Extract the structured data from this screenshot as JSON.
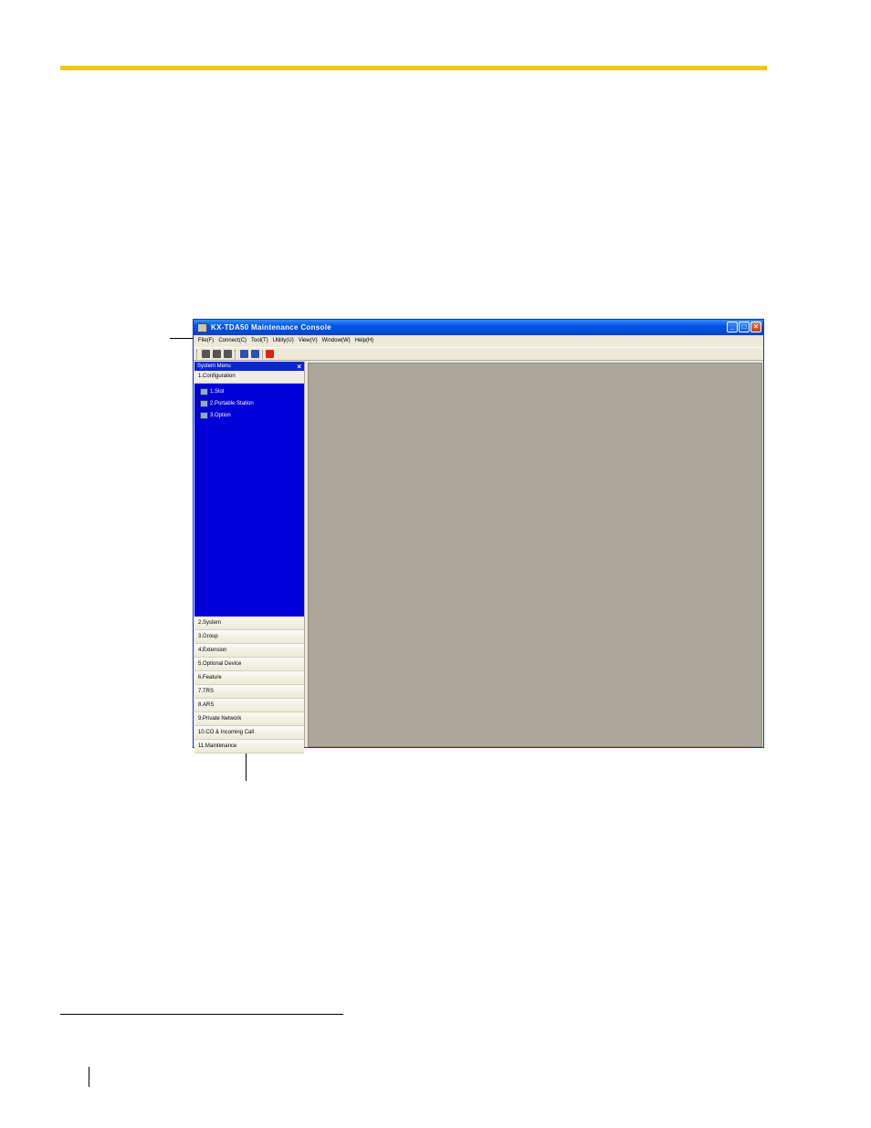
{
  "window": {
    "title": "KX-TDA50 Maintenance Console",
    "controls": {
      "minimize": "_",
      "maximize": "□",
      "close": "×"
    }
  },
  "menubar": {
    "items": [
      "File(F)",
      "Connect(C)",
      "Tool(T)",
      "Utility(U)",
      "View(V)",
      "Window(W)",
      "Help(H)"
    ]
  },
  "toolbar": {
    "icons": [
      "new-icon",
      "open-icon",
      "save-icon",
      "connect-icon",
      "disconnect-icon",
      "exit-icon"
    ]
  },
  "sidebar": {
    "title": "System Menu",
    "close": "×",
    "expanded_section": "1.Configuration",
    "tree_items": [
      "1.Slot",
      "2.Portable Station",
      "3.Option"
    ],
    "sections": [
      "2.System",
      "3.Group",
      "4.Extension",
      "5.Optional Device",
      "6.Feature",
      "7.TRS",
      "8.ARS",
      "9.Private Network",
      "10.CO & Incoming Call",
      "11.Maintenance"
    ]
  },
  "colors": {
    "accent_rule": "#f2c618",
    "titlebar": "#0055e5",
    "tree_background": "#0000d8",
    "workspace": "#aaa69a"
  }
}
